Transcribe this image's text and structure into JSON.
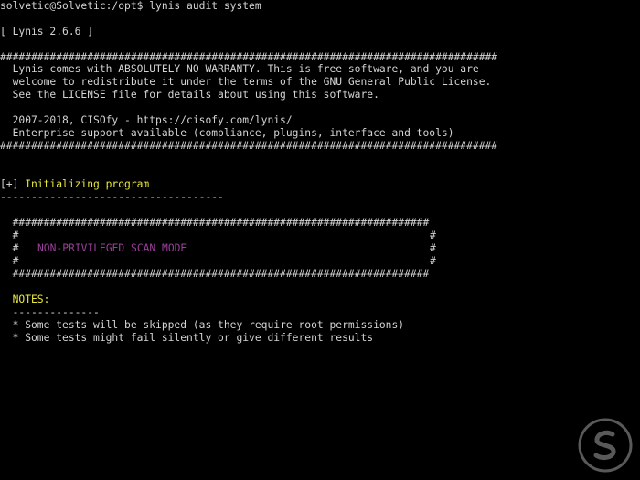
{
  "colors": {
    "background": "#000000",
    "text": "#cfcfcf",
    "highlight": "#e8e83a",
    "mode": "#9a3f9a"
  },
  "lines": {
    "prompt": "solvetic@Solvetic:/opt$ lynis audit system",
    "version": "[ Lynis 2.6.6 ]",
    "hash_long": "################################################################################",
    "license_1": "  Lynis comes with ABSOLUTELY NO WARRANTY. This is free software, and you are",
    "license_2": "  welcome to redistribute it under the terms of the GNU General Public License.",
    "license_3": "  See the LICENSE file for details about using this software.",
    "copyright": "  2007-2018, CISOfy - https://cisofy.com/lynis/",
    "support": "  Enterprise support available (compliance, plugins, interface and tools)",
    "init_marker": "[+]",
    "init_label": " Initializing program",
    "init_rule": "------------------------------------",
    "box_top": "  ###################################################################",
    "box_side_left": "  #",
    "box_side_right": "#",
    "box_mode": "NON-PRIVILEGED SCAN MODE",
    "notes_label": "  NOTES:",
    "notes_rule": "  --------------",
    "note_1": "  * Some tests will be skipped (as they require root permissions)",
    "note_2": "  * Some tests might fail silently or give different results"
  },
  "watermark_icon": "solvetic-logo-icon"
}
